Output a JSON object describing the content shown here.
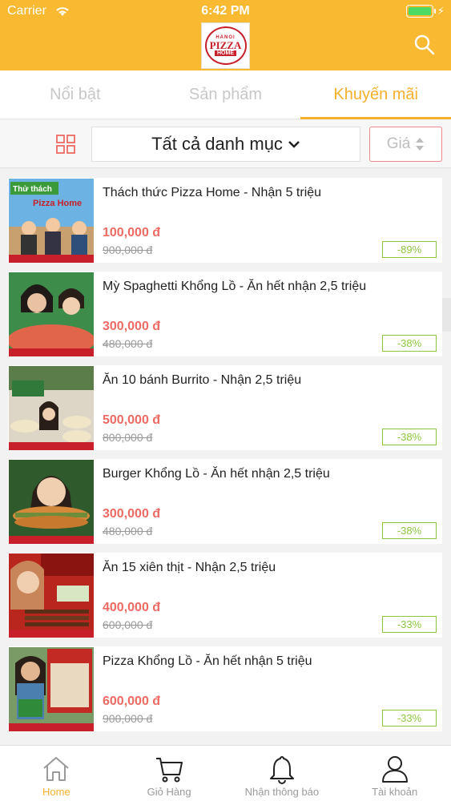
{
  "status": {
    "carrier": "Carrier",
    "time": "6:42 PM"
  },
  "logo": {
    "top": "HANOI",
    "main": "PIZZA",
    "sub": "HOME"
  },
  "tabs": [
    {
      "label": "Nổi bật",
      "active": false
    },
    {
      "label": "Sản phẩm",
      "active": false
    },
    {
      "label": "Khuyến mãi",
      "active": true
    }
  ],
  "filter": {
    "category": "Tất cả danh mục",
    "price": "Giá"
  },
  "products": [
    {
      "name": "Thách thức Pizza Home - Nhận 5 triệu",
      "price": "100,000 đ",
      "old_price": "900,000 đ",
      "discount": "-89%"
    },
    {
      "name": "Mỳ Spaghetti Khổng Lồ - Ăn hết nhận 2,5 triệu",
      "price": "300,000 đ",
      "old_price": "480,000 đ",
      "discount": "-38%"
    },
    {
      "name": "Ăn 10 bánh Burrito - Nhận 2,5 triệu",
      "price": "500,000 đ",
      "old_price": "800,000 đ",
      "discount": "-38%"
    },
    {
      "name": "Burger Khổng Lồ - Ăn hết nhận 2,5 triệu",
      "price": "300,000 đ",
      "old_price": "480,000 đ",
      "discount": "-38%"
    },
    {
      "name": "Ăn 15 xiên thịt - Nhận 2,5 triệu",
      "price": "400,000 đ",
      "old_price": "600,000 đ",
      "discount": "-33%"
    },
    {
      "name": "Pizza Khổng Lồ - Ăn hết nhận 5 triệu",
      "price": "600,000 đ",
      "old_price": "900,000 đ",
      "discount": "-33%"
    }
  ],
  "thumb_text": [
    "Thử thách",
    "Pizza Home"
  ],
  "bottom_nav": [
    {
      "label": "Home",
      "icon": "home-icon",
      "active": true
    },
    {
      "label": "Giỏ Hàng",
      "icon": "cart-icon",
      "active": false
    },
    {
      "label": "Nhận thông báo",
      "icon": "bell-icon",
      "active": false
    },
    {
      "label": "Tài khoản",
      "icon": "user-icon",
      "active": false
    }
  ],
  "colors": {
    "header": "#f9b930",
    "accent": "#f5b02c",
    "price": "#ee6a62",
    "discount": "#8cc63f"
  }
}
